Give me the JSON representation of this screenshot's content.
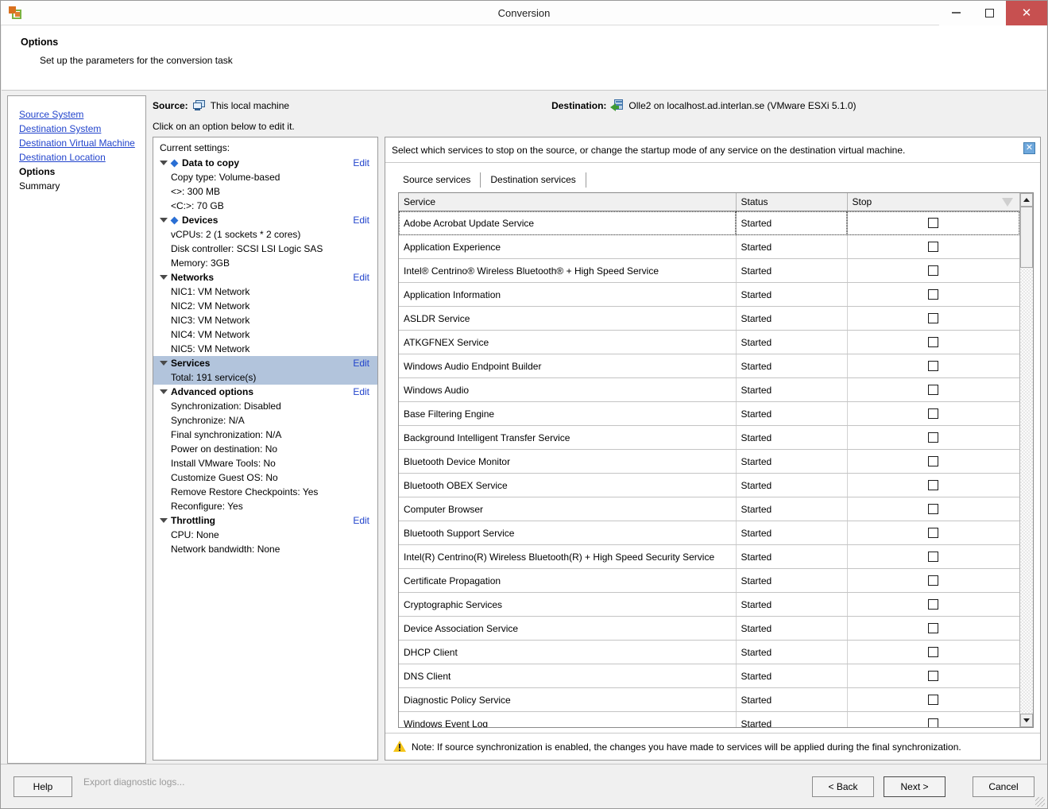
{
  "window": {
    "title": "Conversion",
    "app_icon": "vmware-converter-icon",
    "minimize_label": "Minimize",
    "maximize_label": "Maximize",
    "close_label": "Close"
  },
  "header": {
    "title": "Options",
    "subtitle": "Set up the parameters for the conversion task"
  },
  "sidebar": {
    "items": [
      {
        "label": "Source System",
        "type": "link",
        "name": "sidebar-item-source-system"
      },
      {
        "label": "Destination System",
        "type": "link",
        "name": "sidebar-item-destination-system"
      },
      {
        "label": "Destination Virtual Machine",
        "type": "link",
        "name": "sidebar-item-destination-virtual-machine"
      },
      {
        "label": "Destination Location",
        "type": "link",
        "name": "sidebar-item-destination-location"
      },
      {
        "label": "Options",
        "type": "current",
        "name": "sidebar-item-options"
      },
      {
        "label": "Summary",
        "type": "plain",
        "name": "sidebar-item-summary"
      }
    ]
  },
  "context": {
    "source_label": "Source:",
    "source_value": "This local machine",
    "source_icon": "local-machine-icon",
    "destination_label": "Destination:",
    "destination_value": "Olle2 on localhost.ad.interlan.se (VMware ESXi 5.1.0)",
    "destination_icon": "esxi-host-icon",
    "hint": "Click on an option below to edit it."
  },
  "settings": {
    "heading": "Current settings:",
    "edit_label": "Edit",
    "groups": [
      {
        "name": "data-to-copy",
        "label": "Data to copy",
        "bullet": true,
        "selected": false,
        "edit": "Edit",
        "children": [
          "Copy type: Volume-based",
          "<>: 300 MB",
          "<C:>: 70 GB"
        ]
      },
      {
        "name": "devices",
        "label": "Devices",
        "bullet": true,
        "selected": false,
        "edit": "Edit",
        "children": [
          "vCPUs: 2 (1 sockets * 2 cores)",
          "Disk controller: SCSI LSI Logic SAS",
          "Memory: 3GB"
        ]
      },
      {
        "name": "networks",
        "label": "Networks",
        "bullet": false,
        "selected": false,
        "edit": "Edit",
        "children": [
          "NIC1: VM Network",
          "NIC2: VM Network",
          "NIC3: VM Network",
          "NIC4: VM Network",
          "NIC5: VM Network"
        ]
      },
      {
        "name": "services",
        "label": "Services",
        "bullet": false,
        "selected": true,
        "edit": "Edit",
        "children": [
          "Total: 191 service(s)"
        ]
      },
      {
        "name": "advanced-options",
        "label": "Advanced options",
        "bullet": false,
        "selected": false,
        "edit": "Edit",
        "children": [
          "Synchronization: Disabled",
          "Synchronize: N/A",
          "Final synchronization: N/A",
          "Power on destination: No",
          "Install VMware Tools: No",
          "Customize Guest OS: No",
          "Remove Restore Checkpoints: Yes",
          "Reconfigure: Yes"
        ]
      },
      {
        "name": "throttling",
        "label": "Throttling",
        "bullet": false,
        "selected": false,
        "edit": "Edit",
        "children": [
          "CPU: None",
          "Network bandwidth: None"
        ]
      }
    ]
  },
  "services_panel": {
    "intro": "Select which services to stop on the source, or change the startup mode of any service on the destination virtual machine.",
    "close_glyph": "✕",
    "tabs": [
      {
        "label": "Source services",
        "active": true,
        "name": "tab-source-services"
      },
      {
        "label": "Destination services",
        "active": false,
        "name": "tab-destination-services"
      }
    ],
    "columns": [
      "Service",
      "Status",
      "Stop"
    ],
    "rows": [
      {
        "service": "Adobe Acrobat Update Service",
        "status": "Started",
        "stop": false
      },
      {
        "service": "Application Experience",
        "status": "Started",
        "stop": false
      },
      {
        "service": "Intel® Centrino® Wireless Bluetooth® + High Speed Service",
        "status": "Started",
        "stop": false
      },
      {
        "service": "Application Information",
        "status": "Started",
        "stop": false
      },
      {
        "service": "ASLDR Service",
        "status": "Started",
        "stop": false
      },
      {
        "service": "ATKGFNEX Service",
        "status": "Started",
        "stop": false
      },
      {
        "service": "Windows Audio Endpoint Builder",
        "status": "Started",
        "stop": false
      },
      {
        "service": "Windows Audio",
        "status": "Started",
        "stop": false
      },
      {
        "service": "Base Filtering Engine",
        "status": "Started",
        "stop": false
      },
      {
        "service": "Background Intelligent Transfer Service",
        "status": "Started",
        "stop": false
      },
      {
        "service": "Bluetooth Device Monitor",
        "status": "Started",
        "stop": false
      },
      {
        "service": "Bluetooth OBEX Service",
        "status": "Started",
        "stop": false
      },
      {
        "service": "Computer Browser",
        "status": "Started",
        "stop": false
      },
      {
        "service": "Bluetooth Support Service",
        "status": "Started",
        "stop": false
      },
      {
        "service": "Intel(R) Centrino(R) Wireless Bluetooth(R) + High Speed Security Service",
        "status": "Started",
        "stop": false
      },
      {
        "service": "Certificate Propagation",
        "status": "Started",
        "stop": false
      },
      {
        "service": "Cryptographic Services",
        "status": "Started",
        "stop": false
      },
      {
        "service": "Device Association Service",
        "status": "Started",
        "stop": false
      },
      {
        "service": "DHCP Client",
        "status": "Started",
        "stop": false
      },
      {
        "service": "DNS Client",
        "status": "Started",
        "stop": false
      },
      {
        "service": "Diagnostic Policy Service",
        "status": "Started",
        "stop": false
      },
      {
        "service": "Windows Event Log",
        "status": "Started",
        "stop": false
      }
    ],
    "note": "Note: If source synchronization is enabled, the changes you have made to services will be applied during the final synchronization."
  },
  "footer": {
    "help_label": "Help",
    "export_logs_label": "Export diagnostic logs...",
    "back_label": "< Back",
    "next_label": "Next >",
    "cancel_label": "Cancel"
  }
}
